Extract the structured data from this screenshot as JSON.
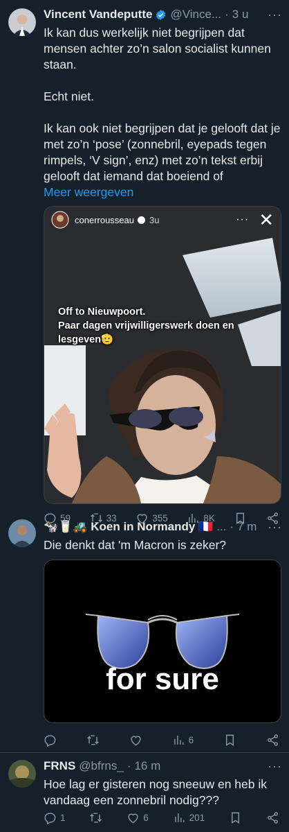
{
  "tweet1": {
    "name": "Vincent Vandeputte",
    "handle": "@Vince...",
    "dot": "·",
    "time": "3 u",
    "text": "Ik kan dus werkelijk niet begrijpen dat mensen achter zo’n salon socialist kunnen staan.\n\nEcht niet.\n\nIk kan ook niet begrijpen dat je gelooft dat je met zo’n ‘pose’ (zonnebril, eyepads tegen rimpels, ‘V sign’, enz) met zo’n tekst erbij gelooft dat iemand dat boeiend of",
    "show_more": "Meer weergeven",
    "story": {
      "user": "conerrousseau",
      "time": "3u",
      "caption_line1": "Off to Nieuwpoort.",
      "caption_line2": "Paar dagen vrijwilligerswerk doen en",
      "caption_line3": "lesgeven🫡"
    },
    "replies": "59",
    "retweets": "33",
    "likes": "355",
    "views": "8K"
  },
  "tweet2": {
    "name": "🐄🥛🚜 Koen in Normandy 🇫🇷",
    "handle": "...",
    "dot": "·",
    "time": "7 m",
    "text": "Die denkt dat 'm Macron is zeker?",
    "media_text": "for sure",
    "views": "6"
  },
  "tweet3": {
    "name": "FRNS",
    "handle": "@bfrns_",
    "dot": "·",
    "time": "16 m",
    "text": "Hoe lag er gisteren nog sneeuw en heb ik vandaag een zonnebril nodig???",
    "replies": "1",
    "likes": "6",
    "views": "201"
  },
  "colors": {
    "background": "#15202b",
    "text": "#e7e9ea",
    "secondary": "#8b98a5",
    "link": "#1d9bf0",
    "divider": "#38444d",
    "verified": "#1d9bf0"
  }
}
